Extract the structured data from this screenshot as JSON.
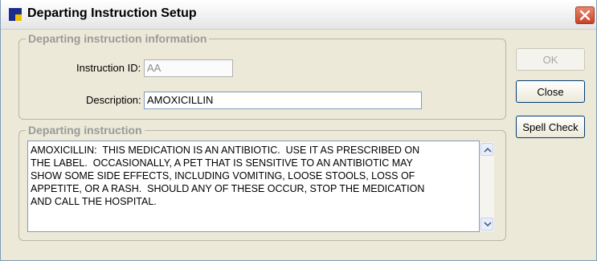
{
  "window": {
    "title": "Departing Instruction Setup",
    "icon": "app-icon",
    "close_icon": "close-icon"
  },
  "info_group": {
    "title": "Departing instruction information",
    "instruction_id_label": "Instruction ID:",
    "instruction_id_value": "AA",
    "description_label": "Description:",
    "description_value": "AMOXICILLIN"
  },
  "instruction_group": {
    "title": "Departing instruction",
    "text": "AMOXICILLIN:  THIS MEDICATION IS AN ANTIBIOTIC.  USE IT AS PRESCRIBED ON\nTHE LABEL.  OCCASIONALLY, A PET THAT IS SENSITIVE TO AN ANTIBIOTIC MAY\nSHOW SOME SIDE EFFECTS, INCLUDING VOMITING, LOOSE STOOLS, LOSS OF\nAPPETITE, OR A RASH.  SHOULD ANY OF THESE OCCUR, STOP THE MEDICATION\nAND CALL THE HOSPITAL."
  },
  "buttons": {
    "ok": "OK",
    "close": "Close",
    "spell_check": "Spell Check"
  }
}
